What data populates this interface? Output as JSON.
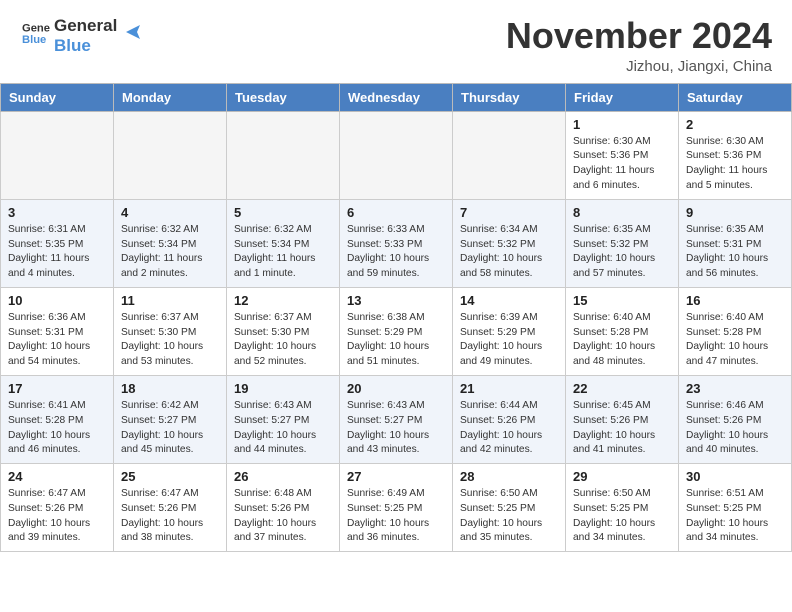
{
  "header": {
    "logo_line1": "General",
    "logo_line2": "Blue",
    "month": "November 2024",
    "location": "Jizhou, Jiangxi, China"
  },
  "weekdays": [
    "Sunday",
    "Monday",
    "Tuesday",
    "Wednesday",
    "Thursday",
    "Friday",
    "Saturday"
  ],
  "weeks": [
    [
      {
        "day": "",
        "info": ""
      },
      {
        "day": "",
        "info": ""
      },
      {
        "day": "",
        "info": ""
      },
      {
        "day": "",
        "info": ""
      },
      {
        "day": "",
        "info": ""
      },
      {
        "day": "1",
        "info": "Sunrise: 6:30 AM\nSunset: 5:36 PM\nDaylight: 11 hours\nand 6 minutes."
      },
      {
        "day": "2",
        "info": "Sunrise: 6:30 AM\nSunset: 5:36 PM\nDaylight: 11 hours\nand 5 minutes."
      }
    ],
    [
      {
        "day": "3",
        "info": "Sunrise: 6:31 AM\nSunset: 5:35 PM\nDaylight: 11 hours\nand 4 minutes."
      },
      {
        "day": "4",
        "info": "Sunrise: 6:32 AM\nSunset: 5:34 PM\nDaylight: 11 hours\nand 2 minutes."
      },
      {
        "day": "5",
        "info": "Sunrise: 6:32 AM\nSunset: 5:34 PM\nDaylight: 11 hours\nand 1 minute."
      },
      {
        "day": "6",
        "info": "Sunrise: 6:33 AM\nSunset: 5:33 PM\nDaylight: 10 hours\nand 59 minutes."
      },
      {
        "day": "7",
        "info": "Sunrise: 6:34 AM\nSunset: 5:32 PM\nDaylight: 10 hours\nand 58 minutes."
      },
      {
        "day": "8",
        "info": "Sunrise: 6:35 AM\nSunset: 5:32 PM\nDaylight: 10 hours\nand 57 minutes."
      },
      {
        "day": "9",
        "info": "Sunrise: 6:35 AM\nSunset: 5:31 PM\nDaylight: 10 hours\nand 56 minutes."
      }
    ],
    [
      {
        "day": "10",
        "info": "Sunrise: 6:36 AM\nSunset: 5:31 PM\nDaylight: 10 hours\nand 54 minutes."
      },
      {
        "day": "11",
        "info": "Sunrise: 6:37 AM\nSunset: 5:30 PM\nDaylight: 10 hours\nand 53 minutes."
      },
      {
        "day": "12",
        "info": "Sunrise: 6:37 AM\nSunset: 5:30 PM\nDaylight: 10 hours\nand 52 minutes."
      },
      {
        "day": "13",
        "info": "Sunrise: 6:38 AM\nSunset: 5:29 PM\nDaylight: 10 hours\nand 51 minutes."
      },
      {
        "day": "14",
        "info": "Sunrise: 6:39 AM\nSunset: 5:29 PM\nDaylight: 10 hours\nand 49 minutes."
      },
      {
        "day": "15",
        "info": "Sunrise: 6:40 AM\nSunset: 5:28 PM\nDaylight: 10 hours\nand 48 minutes."
      },
      {
        "day": "16",
        "info": "Sunrise: 6:40 AM\nSunset: 5:28 PM\nDaylight: 10 hours\nand 47 minutes."
      }
    ],
    [
      {
        "day": "17",
        "info": "Sunrise: 6:41 AM\nSunset: 5:28 PM\nDaylight: 10 hours\nand 46 minutes."
      },
      {
        "day": "18",
        "info": "Sunrise: 6:42 AM\nSunset: 5:27 PM\nDaylight: 10 hours\nand 45 minutes."
      },
      {
        "day": "19",
        "info": "Sunrise: 6:43 AM\nSunset: 5:27 PM\nDaylight: 10 hours\nand 44 minutes."
      },
      {
        "day": "20",
        "info": "Sunrise: 6:43 AM\nSunset: 5:27 PM\nDaylight: 10 hours\nand 43 minutes."
      },
      {
        "day": "21",
        "info": "Sunrise: 6:44 AM\nSunset: 5:26 PM\nDaylight: 10 hours\nand 42 minutes."
      },
      {
        "day": "22",
        "info": "Sunrise: 6:45 AM\nSunset: 5:26 PM\nDaylight: 10 hours\nand 41 minutes."
      },
      {
        "day": "23",
        "info": "Sunrise: 6:46 AM\nSunset: 5:26 PM\nDaylight: 10 hours\nand 40 minutes."
      }
    ],
    [
      {
        "day": "24",
        "info": "Sunrise: 6:47 AM\nSunset: 5:26 PM\nDaylight: 10 hours\nand 39 minutes."
      },
      {
        "day": "25",
        "info": "Sunrise: 6:47 AM\nSunset: 5:26 PM\nDaylight: 10 hours\nand 38 minutes."
      },
      {
        "day": "26",
        "info": "Sunrise: 6:48 AM\nSunset: 5:26 PM\nDaylight: 10 hours\nand 37 minutes."
      },
      {
        "day": "27",
        "info": "Sunrise: 6:49 AM\nSunset: 5:25 PM\nDaylight: 10 hours\nand 36 minutes."
      },
      {
        "day": "28",
        "info": "Sunrise: 6:50 AM\nSunset: 5:25 PM\nDaylight: 10 hours\nand 35 minutes."
      },
      {
        "day": "29",
        "info": "Sunrise: 6:50 AM\nSunset: 5:25 PM\nDaylight: 10 hours\nand 34 minutes."
      },
      {
        "day": "30",
        "info": "Sunrise: 6:51 AM\nSunset: 5:25 PM\nDaylight: 10 hours\nand 34 minutes."
      }
    ]
  ]
}
